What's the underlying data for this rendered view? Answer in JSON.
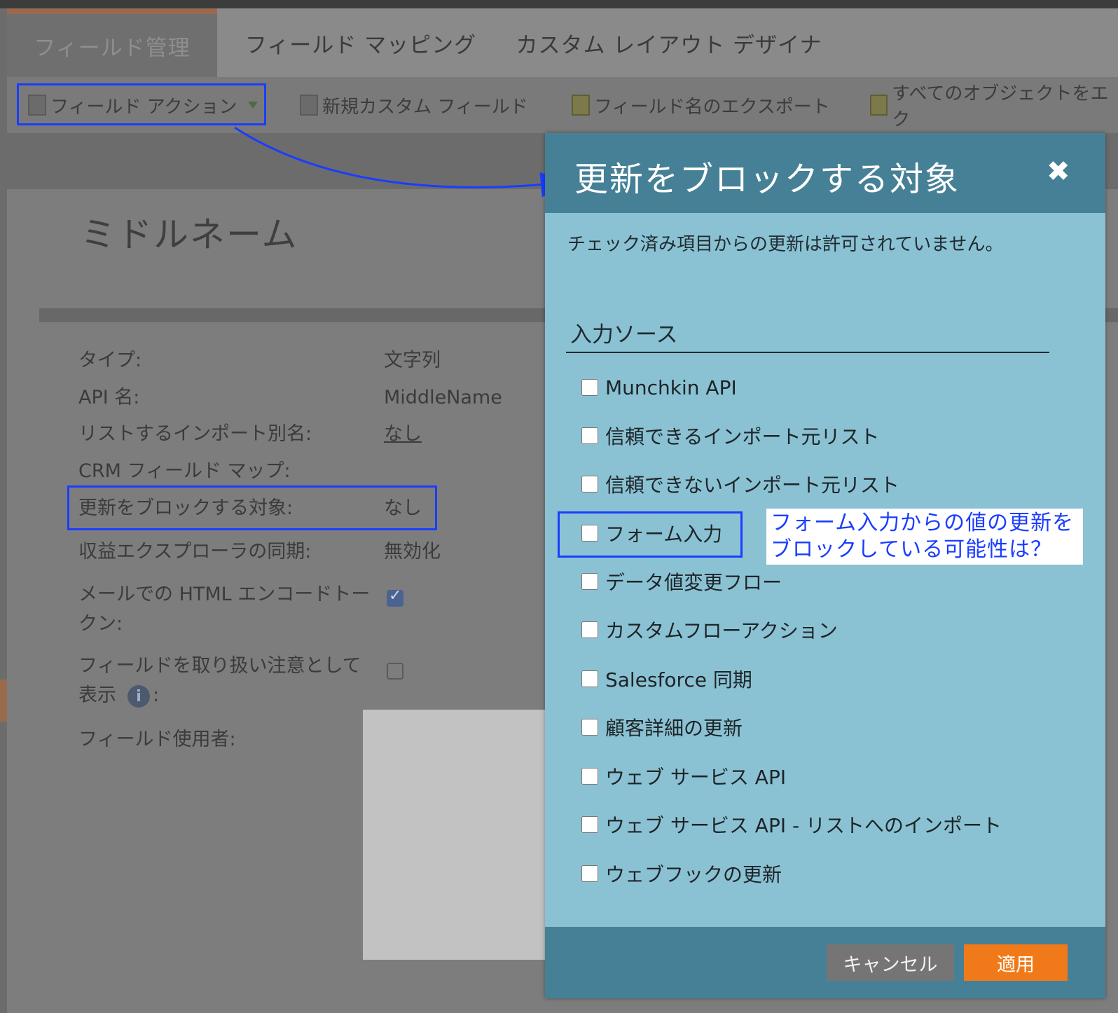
{
  "tabs": {
    "field_management": "フィールド管理",
    "field_mapping": "フィールド マッピング",
    "custom_layout_designer": "カスタム レイアウト デザイナ"
  },
  "toolbar": {
    "field_actions": "フィールド アクション",
    "new_custom_field": "新規カスタム フィールド",
    "export_field_names": "フィールド名のエクスポート",
    "export_all_objects": "すべてのオブジェクトをエク"
  },
  "field": {
    "title": "ミドルネーム",
    "properties": {
      "type_label": "タイプ:",
      "type_value": "文字列",
      "api_label": "API 名:",
      "api_value": "MiddleName",
      "import_alias_label": "リストするインポート別名:",
      "import_alias_value": "なし",
      "crm_map_label": "CRM フィールド マップ:",
      "block_updates_label": "更新をブロックする対象:",
      "block_updates_value": "なし",
      "revenue_sync_label": "収益エクスプローラの同期:",
      "revenue_sync_value": "無効化",
      "html_encode_label": "メールでの HTML エンコードトークン:",
      "html_encode_checked": true,
      "sensitive_label_1": "フィールドを取り扱い注意として",
      "sensitive_label_2": "表示",
      "sensitive_label_suffix": ":",
      "sensitive_checked": false,
      "info_icon_glyph": "i",
      "used_by_label": "フィールド使用者:"
    }
  },
  "modal": {
    "title": "更新をブロックする対象",
    "close_glyph": "✖",
    "description": "チェック済み項目からの更新は許可されていません。",
    "section_title": "入力ソース",
    "options": [
      {
        "label": "Munchkin API",
        "checked": false
      },
      {
        "label": "信頼できるインポート元リスト",
        "checked": false
      },
      {
        "label": "信頼できないインポート元リスト",
        "checked": false
      },
      {
        "label": "フォーム入力",
        "checked": false
      },
      {
        "label": "データ値変更フロー",
        "checked": false
      },
      {
        "label": "カスタムフローアクション",
        "checked": false
      },
      {
        "label": "Salesforce 同期",
        "checked": false
      },
      {
        "label": "顧客詳細の更新",
        "checked": false
      },
      {
        "label": "ウェブ サービス API",
        "checked": false
      },
      {
        "label": "ウェブ サービス API - リストへのインポート",
        "checked": false
      },
      {
        "label": "ウェブフックの更新",
        "checked": false
      }
    ],
    "cancel_label": "キャンセル",
    "apply_label": "適用"
  },
  "annotation": {
    "callout_line1": "フォーム入力からの値の更新を",
    "callout_line2": "ブロックしている可能性は？",
    "highlight_color": "#1a3dff"
  },
  "colors": {
    "modal_header": "#468096",
    "modal_body": "#8bc2d3",
    "apply_button": "#f07a1a",
    "cancel_button": "#757575"
  }
}
